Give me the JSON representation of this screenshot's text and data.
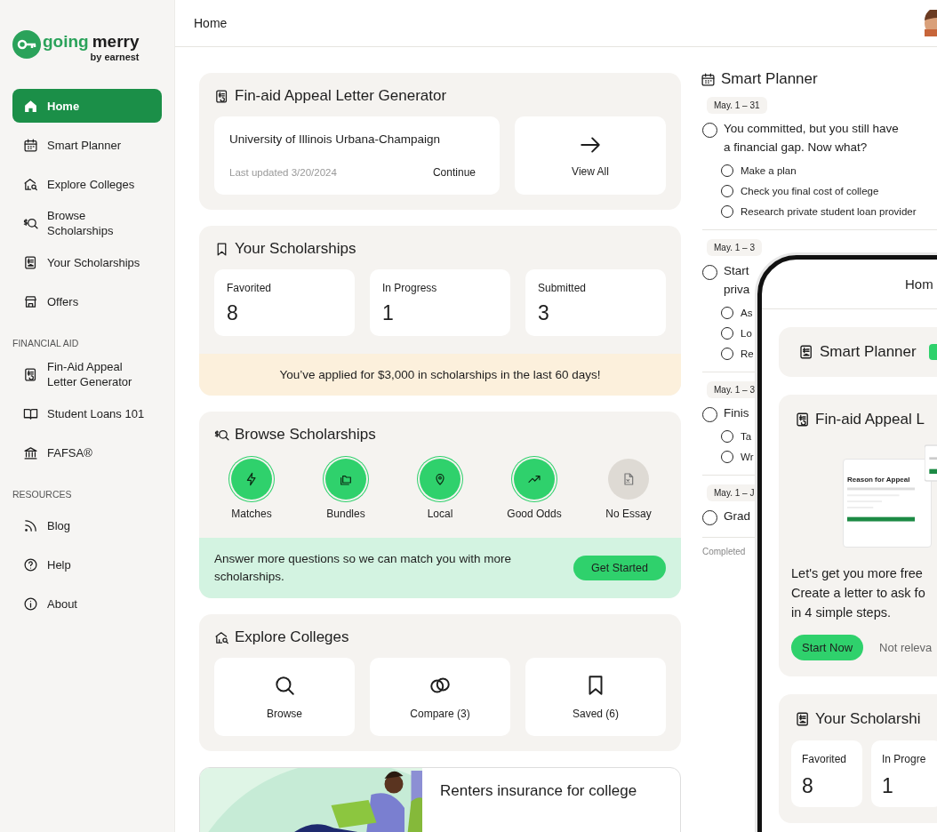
{
  "sidebar": {
    "logo": {
      "word_1": "going",
      "word_2": "merry",
      "tagline": "by earnest"
    },
    "sections": [
      {
        "items": [
          {
            "label": "Home",
            "selected": true
          },
          {
            "label": "Smart Planner",
            "selected": false
          },
          {
            "label": "Explore Colleges",
            "selected": false
          },
          {
            "label": "Browse Scholarships",
            "selected": false
          },
          {
            "label": "Your Scholarships",
            "selected": false
          },
          {
            "label": "Offers",
            "selected": false
          }
        ]
      },
      {
        "heading": "FINANCIAL AID",
        "items": [
          {
            "label": "Fin-Aid Appeal Letter Generator",
            "selected": false
          },
          {
            "label": "Student Loans 101",
            "selected": false
          },
          {
            "label": "FAFSA®",
            "selected": false
          }
        ]
      },
      {
        "heading": "RESOURCES",
        "items": [
          {
            "label": "Blog",
            "selected": false
          },
          {
            "label": "Help",
            "selected": false
          },
          {
            "label": "About",
            "selected": false
          }
        ]
      }
    ]
  },
  "header": {
    "title": "Home"
  },
  "appeal": {
    "title": "Fin-aid Appeal Letter Generator",
    "school": "University of Illinois Urbana-Champaign",
    "updated": "Last updated 3/20/2024",
    "action": "Continue",
    "view_all": "View All"
  },
  "scholarships": {
    "title": "Your Scholarships",
    "stats": [
      {
        "label": "Favorited",
        "value": "8"
      },
      {
        "label": "In Progress",
        "value": "1"
      },
      {
        "label": "Submitted",
        "value": "3"
      }
    ],
    "banner": "You’ve applied for $3,000 in scholarships in the last 60 days!"
  },
  "browse": {
    "title": "Browse Scholarships",
    "filters": [
      {
        "label": "Matches",
        "disabled": false
      },
      {
        "label": "Bundles",
        "disabled": false
      },
      {
        "label": "Local",
        "disabled": false
      },
      {
        "label": "Good Odds",
        "disabled": false
      },
      {
        "label": "No Essay",
        "disabled": true
      }
    ],
    "prompt": "Answer more questions so we can match you with more scholarships.",
    "button": "Get Started"
  },
  "explore": {
    "title": "Explore Colleges",
    "tiles": [
      {
        "label": "Browse"
      },
      {
        "label": "Compare (3)"
      },
      {
        "label": "Saved (6)"
      }
    ]
  },
  "article": {
    "title": "Renters insurance for college"
  },
  "planner": {
    "title": "Smart Planner",
    "groups": [
      {
        "date": "May. 1 – 31",
        "task": {
          "lines": [
            "You committed, but you still have",
            "a financial gap. Now what?"
          ],
          "checked": false
        },
        "subtasks": [
          {
            "text": "Make a plan",
            "checked": false
          },
          {
            "text": "Check you final cost of college",
            "checked": false
          },
          {
            "text": "Research private student loan provider",
            "checked": false
          }
        ]
      },
      {
        "date": "May. 1 – 3",
        "task": {
          "lines": [
            "Start",
            "priva"
          ],
          "checked": false
        },
        "subtasks": [
          {
            "text": "As",
            "checked": false
          },
          {
            "text": "Lo",
            "checked": false
          },
          {
            "text": "Re",
            "checked": false
          }
        ]
      },
      {
        "date": "May. 1 – 3",
        "task": {
          "lines": [
            "Finis"
          ],
          "checked": false
        },
        "subtasks": [
          {
            "text": "Ta",
            "checked": false
          },
          {
            "text": "Wr",
            "checked": false
          }
        ]
      },
      {
        "date": "May. 1 – J",
        "task": {
          "lines": [
            "Grad"
          ],
          "checked": false
        }
      }
    ],
    "completed": "Completed"
  },
  "phone": {
    "title": "Hom",
    "planner_title": "Smart Planner",
    "appeal_title": "Fin-aid Appeal L",
    "preview_heading": "Reason for Appeal",
    "text_lines": [
      "Let's get you more free",
      "Create a letter to ask fo",
      "in 4 simple steps."
    ],
    "primary": "Start Now",
    "secondary": "Not releva",
    "scholarships_title": "Your Scholarshi",
    "stats": [
      {
        "label": "Favorited",
        "value": "8"
      },
      {
        "label": "In Progre",
        "value": "1"
      }
    ]
  }
}
